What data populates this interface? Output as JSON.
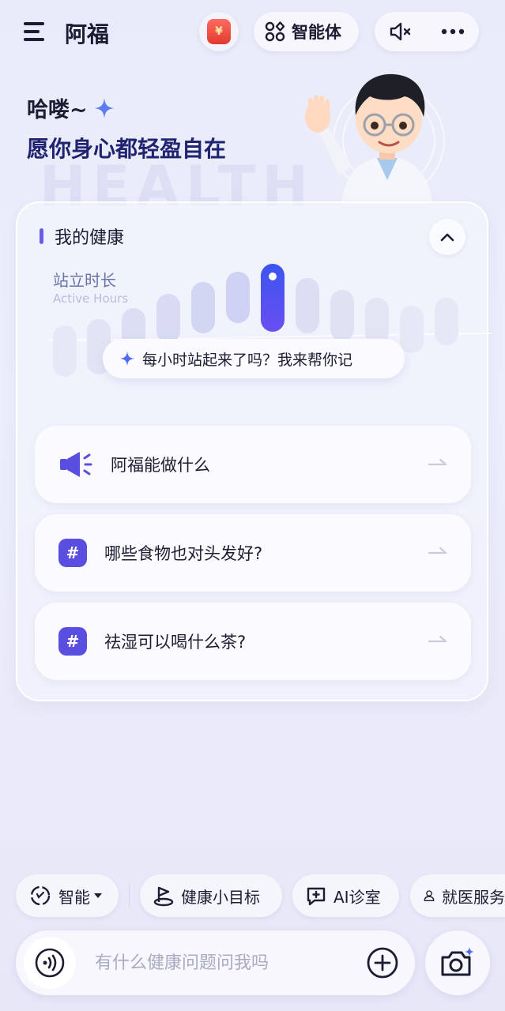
{
  "header": {
    "title": "阿福",
    "coin_symbol": "¥",
    "agent_label": "智能体"
  },
  "greeting": {
    "line1": "哈喽~",
    "line2": "愿你身心都轻盈自在"
  },
  "health": {
    "section_title": "我的健康",
    "metric_cn": "站立时长",
    "metric_en": "Active Hours",
    "tip": "每小时站起来了吗？我来帮你记"
  },
  "suggestions": [
    {
      "label": "阿福能做什么",
      "icon": "megaphone-icon"
    },
    {
      "label": "哪些食物也对头发好?",
      "icon": "hash-icon"
    },
    {
      "label": "祛湿可以喝什么茶?",
      "icon": "hash-icon"
    }
  ],
  "hash_glyph": "#",
  "chips": {
    "mode": "智能",
    "goal": "健康小目标",
    "clinic": "AI诊室",
    "service": "就医服务"
  },
  "input": {
    "placeholder": "有什么健康问题问我吗"
  },
  "colors": {
    "accent": "#5a4ee0",
    "dark_text": "#1c1d33",
    "headline_navy": "#1f2370"
  }
}
